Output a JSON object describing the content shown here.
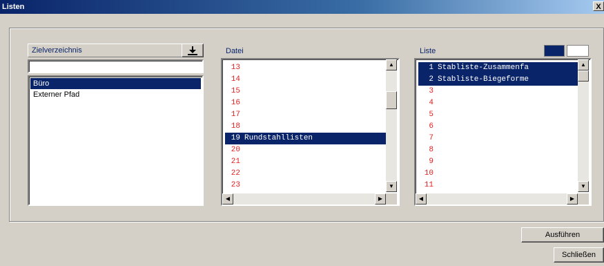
{
  "window": {
    "title": "Listen",
    "close_glyph": "X"
  },
  "ziel": {
    "header": "Zielverzeichnis",
    "download_icon": "download-icon",
    "input_value": "",
    "items": [
      {
        "label": "Büro",
        "selected": true
      },
      {
        "label": "Externer Pfad",
        "selected": false
      }
    ]
  },
  "datei": {
    "header": "Datei",
    "rows": [
      {
        "n": "13",
        "t": ""
      },
      {
        "n": "14",
        "t": ""
      },
      {
        "n": "15",
        "t": ""
      },
      {
        "n": "16",
        "t": ""
      },
      {
        "n": "17",
        "t": ""
      },
      {
        "n": "18",
        "t": ""
      },
      {
        "n": "19",
        "t": "Rundstahllisten",
        "selected": true
      },
      {
        "n": "20",
        "t": ""
      },
      {
        "n": "21",
        "t": ""
      },
      {
        "n": "22",
        "t": ""
      },
      {
        "n": "23",
        "t": ""
      }
    ]
  },
  "liste": {
    "header": "Liste",
    "color_swatches": [
      "#0a246a",
      "#ffffff"
    ],
    "rows": [
      {
        "n": "1",
        "t": "Stabliste-Zusammenfa",
        "selected": true
      },
      {
        "n": "2",
        "t": "Stabliste-Biegeforme",
        "selected": true
      },
      {
        "n": "3",
        "t": ""
      },
      {
        "n": "4",
        "t": ""
      },
      {
        "n": "5",
        "t": ""
      },
      {
        "n": "6",
        "t": ""
      },
      {
        "n": "7",
        "t": ""
      },
      {
        "n": "8",
        "t": ""
      },
      {
        "n": "9",
        "t": ""
      },
      {
        "n": "10",
        "t": ""
      },
      {
        "n": "11",
        "t": ""
      }
    ]
  },
  "buttons": {
    "run": "Ausführen",
    "close": "Schließen"
  },
  "scroll_glyphs": {
    "up": "▲",
    "down": "▼",
    "left": "◀",
    "right": "▶"
  }
}
